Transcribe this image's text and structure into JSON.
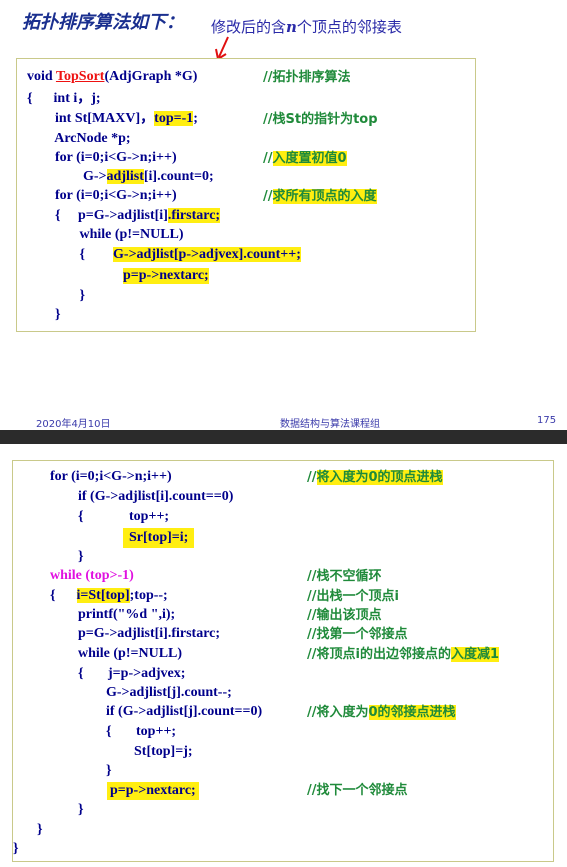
{
  "slide1": {
    "title": "拓扑排序算法如下：",
    "subtitle_pre": "修改后的含",
    "subtitle_n": "n",
    "subtitle_post": "个顶点的邻接表",
    "footer_date": "2020年4月10日",
    "footer_course": "数据结构与算法课程组",
    "footer_page": "175"
  },
  "code1": {
    "l1a": "void ",
    "l1b": "TopSort",
    "l1c": "(AdjGraph *G)",
    "l1_cm": "//拓扑排序算法",
    "l2": "{      int i，j;",
    "l3a": "        int St[MAXV]，",
    "l3b": "top=-1",
    "l3c": ";",
    "l3_cm": "//栈St的指针为top",
    "l4": "        ArcNode *p;",
    "l5": "        for (i=0;i<G->n;i++)",
    "l5_cm_a": "//",
    "l5_cm_b": "入度置初值0",
    "l6a": "                G->",
    "l6b": "adjlist",
    "l6c": "[i].count=0;",
    "l7": "        for (i=0;i<G->n;i++)",
    "l7_cm_a": "//",
    "l7_cm_b": "求所有顶点的入度",
    "l8a": "        {     p=G->adjlist[i]",
    "l8b": ".firstarc;",
    "l9": "               while (p!=NULL)",
    "l10a": "               {        ",
    "l10b": "G->adjlist[p->adjvex].count++;",
    "l11": "p=p->nextarc;",
    "l12": "               }",
    "l13": "        }"
  },
  "code2": {
    "l1": "for (i=0;i<G->n;i++)",
    "l1_cm_a": "//",
    "l1_cm_b": "将入度为0的顶点进栈",
    "l2": "        if (G->adjlist[i].count==0)",
    "l3": "        {             top++;",
    "l4": "Sr[top]=i;",
    "l5": "        }",
    "l6": "while (top>-1)",
    "l6_cm": "//栈不空循环",
    "l7a": "{      ",
    "l7b": "i=St[top]",
    "l7c": ";top--;",
    "l7_cm": "//出栈一个顶点i",
    "l8": "        printf(\"%d \",i);",
    "l8_cm": "//输出该顶点",
    "l9": "        p=G->adjlist[i].firstarc;",
    "l9_cm": "//找第一个邻接点",
    "l10": "        while (p!=NULL)",
    "l10_cm_a": "//将顶点i的出边邻接点的",
    "l10_cm_b": "入度减1",
    "l11": "        {       j=p->adjvex;",
    "l12": "                G->adjlist[j].count--;",
    "l13": "                if (G->adjlist[j].count==0)",
    "l13_cm_a": "//将入度为",
    "l13_cm_b": "0的邻接点进栈",
    "l14": "                {       top++;",
    "l15": "                        St[top]=j;",
    "l16": "                }",
    "l17": "p=p->nextarc;",
    "l17_cm": "//找下一个邻接点",
    "l18": "        }",
    "l19": "    }",
    "l20": "}"
  }
}
